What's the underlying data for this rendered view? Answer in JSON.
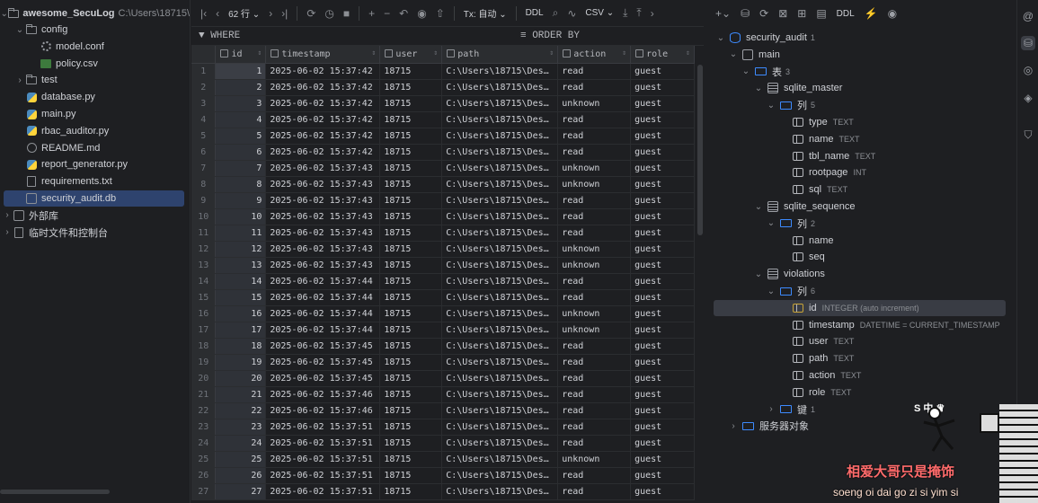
{
  "project": {
    "root_name": "awesome_SecuLog",
    "root_path": "C:\\Users\\18715\\",
    "items": [
      {
        "label": "config",
        "kind": "folder",
        "depth": 1,
        "open": true
      },
      {
        "label": "model.conf",
        "kind": "cfg",
        "depth": 2
      },
      {
        "label": "policy.csv",
        "kind": "csv",
        "depth": 2
      },
      {
        "label": "test",
        "kind": "folder",
        "depth": 1,
        "open": false
      },
      {
        "label": "database.py",
        "kind": "py",
        "depth": 1
      },
      {
        "label": "main.py",
        "kind": "py",
        "depth": 1
      },
      {
        "label": "rbac_auditor.py",
        "kind": "py",
        "depth": 1
      },
      {
        "label": "README.md",
        "kind": "md",
        "depth": 1
      },
      {
        "label": "report_generator.py",
        "kind": "py",
        "depth": 1
      },
      {
        "label": "requirements.txt",
        "kind": "txt",
        "depth": 1
      },
      {
        "label": "security_audit.db",
        "kind": "db",
        "depth": 1,
        "selected": true
      },
      {
        "label": "外部库",
        "kind": "lib",
        "depth": 0
      },
      {
        "label": "临时文件和控制台",
        "kind": "scratch",
        "depth": 0
      }
    ]
  },
  "toolbar": {
    "rows_label": "62 行 ⌄",
    "tx_label": "Tx: 自动 ⌄",
    "ddl_label": "DDL",
    "export_label": "CSV ⌄"
  },
  "filter": {
    "where": "WHERE",
    "order": "ORDER BY"
  },
  "grid": {
    "columns": [
      "id",
      "timestamp",
      "user",
      "path",
      "action",
      "role"
    ],
    "rows": [
      [
        "1",
        "2025-06-02 15:37:42",
        "18715",
        "C:\\Users\\18715\\Des…",
        "read",
        "guest"
      ],
      [
        "2",
        "2025-06-02 15:37:42",
        "18715",
        "C:\\Users\\18715\\Des…",
        "read",
        "guest"
      ],
      [
        "3",
        "2025-06-02 15:37:42",
        "18715",
        "C:\\Users\\18715\\Des…",
        "unknown",
        "guest"
      ],
      [
        "4",
        "2025-06-02 15:37:42",
        "18715",
        "C:\\Users\\18715\\Des…",
        "read",
        "guest"
      ],
      [
        "5",
        "2025-06-02 15:37:42",
        "18715",
        "C:\\Users\\18715\\Des…",
        "read",
        "guest"
      ],
      [
        "6",
        "2025-06-02 15:37:42",
        "18715",
        "C:\\Users\\18715\\Des…",
        "read",
        "guest"
      ],
      [
        "7",
        "2025-06-02 15:37:43",
        "18715",
        "C:\\Users\\18715\\Des…",
        "unknown",
        "guest"
      ],
      [
        "8",
        "2025-06-02 15:37:43",
        "18715",
        "C:\\Users\\18715\\Des…",
        "unknown",
        "guest"
      ],
      [
        "9",
        "2025-06-02 15:37:43",
        "18715",
        "C:\\Users\\18715\\Des…",
        "read",
        "guest"
      ],
      [
        "10",
        "2025-06-02 15:37:43",
        "18715",
        "C:\\Users\\18715\\Des…",
        "read",
        "guest"
      ],
      [
        "11",
        "2025-06-02 15:37:43",
        "18715",
        "C:\\Users\\18715\\Des…",
        "read",
        "guest"
      ],
      [
        "12",
        "2025-06-02 15:37:43",
        "18715",
        "C:\\Users\\18715\\Des…",
        "unknown",
        "guest"
      ],
      [
        "13",
        "2025-06-02 15:37:43",
        "18715",
        "C:\\Users\\18715\\Des…",
        "unknown",
        "guest"
      ],
      [
        "14",
        "2025-06-02 15:37:44",
        "18715",
        "C:\\Users\\18715\\Des…",
        "read",
        "guest"
      ],
      [
        "15",
        "2025-06-02 15:37:44",
        "18715",
        "C:\\Users\\18715\\Des…",
        "read",
        "guest"
      ],
      [
        "16",
        "2025-06-02 15:37:44",
        "18715",
        "C:\\Users\\18715\\Des…",
        "unknown",
        "guest"
      ],
      [
        "17",
        "2025-06-02 15:37:44",
        "18715",
        "C:\\Users\\18715\\Des…",
        "unknown",
        "guest"
      ],
      [
        "18",
        "2025-06-02 15:37:45",
        "18715",
        "C:\\Users\\18715\\Des…",
        "read",
        "guest"
      ],
      [
        "19",
        "2025-06-02 15:37:45",
        "18715",
        "C:\\Users\\18715\\Des…",
        "read",
        "guest"
      ],
      [
        "20",
        "2025-06-02 15:37:45",
        "18715",
        "C:\\Users\\18715\\Des…",
        "read",
        "guest"
      ],
      [
        "21",
        "2025-06-02 15:37:46",
        "18715",
        "C:\\Users\\18715\\Des…",
        "read",
        "guest"
      ],
      [
        "22",
        "2025-06-02 15:37:46",
        "18715",
        "C:\\Users\\18715\\Des…",
        "read",
        "guest"
      ],
      [
        "23",
        "2025-06-02 15:37:51",
        "18715",
        "C:\\Users\\18715\\Des…",
        "read",
        "guest"
      ],
      [
        "24",
        "2025-06-02 15:37:51",
        "18715",
        "C:\\Users\\18715\\Des…",
        "read",
        "guest"
      ],
      [
        "25",
        "2025-06-02 15:37:51",
        "18715",
        "C:\\Users\\18715\\Des…",
        "unknown",
        "guest"
      ],
      [
        "26",
        "2025-06-02 15:37:51",
        "18715",
        "C:\\Users\\18715\\Des…",
        "read",
        "guest"
      ],
      [
        "27",
        "2025-06-02 15:37:51",
        "18715",
        "C:\\Users\\18715\\Des…",
        "read",
        "guest"
      ]
    ]
  },
  "dbtree": {
    "ddl_label": "DDL",
    "nodes": [
      {
        "label": "security_audit",
        "count": "1",
        "kind": "ds",
        "depth": 0,
        "chev": "⌄"
      },
      {
        "label": "main",
        "count": "",
        "kind": "schema",
        "depth": 1,
        "chev": "⌄"
      },
      {
        "label": "表",
        "count": "3",
        "kind": "folder",
        "depth": 2,
        "chev": "⌄"
      },
      {
        "label": "sqlite_master",
        "count": "",
        "kind": "table",
        "depth": 3,
        "chev": "⌄"
      },
      {
        "label": "列",
        "count": "5",
        "kind": "folder",
        "depth": 4,
        "chev": "⌄"
      },
      {
        "label": "type",
        "type": "TEXT",
        "kind": "col",
        "depth": 5
      },
      {
        "label": "name",
        "type": "TEXT",
        "kind": "col",
        "depth": 5
      },
      {
        "label": "tbl_name",
        "type": "TEXT",
        "kind": "col",
        "depth": 5
      },
      {
        "label": "rootpage",
        "type": "INT",
        "kind": "col",
        "depth": 5
      },
      {
        "label": "sql",
        "type": "TEXT",
        "kind": "col",
        "depth": 5
      },
      {
        "label": "sqlite_sequence",
        "count": "",
        "kind": "table",
        "depth": 3,
        "chev": "⌄"
      },
      {
        "label": "列",
        "count": "2",
        "kind": "folder",
        "depth": 4,
        "chev": "⌄"
      },
      {
        "label": "name",
        "type": "",
        "kind": "col",
        "depth": 5
      },
      {
        "label": "seq",
        "type": "",
        "kind": "col",
        "depth": 5
      },
      {
        "label": "violations",
        "count": "",
        "kind": "table",
        "depth": 3,
        "chev": "⌄"
      },
      {
        "label": "列",
        "count": "6",
        "kind": "folder",
        "depth": 4,
        "chev": "⌄"
      },
      {
        "label": "id",
        "type": "INTEGER (auto increment)",
        "kind": "key",
        "depth": 5,
        "selected": true
      },
      {
        "label": "timestamp",
        "type": "DATETIME = CURRENT_TIMESTAMP",
        "kind": "col",
        "depth": 5
      },
      {
        "label": "user",
        "type": "TEXT",
        "kind": "col",
        "depth": 5
      },
      {
        "label": "path",
        "type": "TEXT",
        "kind": "col",
        "depth": 5
      },
      {
        "label": "action",
        "type": "TEXT",
        "kind": "col",
        "depth": 5
      },
      {
        "label": "role",
        "type": "TEXT",
        "kind": "col",
        "depth": 5
      },
      {
        "label": "键",
        "count": "1",
        "kind": "folder",
        "depth": 4,
        "chev": "›"
      },
      {
        "label": "服务器对象",
        "count": "",
        "kind": "folder",
        "depth": 1,
        "chev": "›"
      }
    ]
  },
  "overlay": {
    "line1": "相爱大哥只是掩饰",
    "line2": "soeng oi dai go zi si yim si",
    "mark": "S 中 ♛"
  }
}
